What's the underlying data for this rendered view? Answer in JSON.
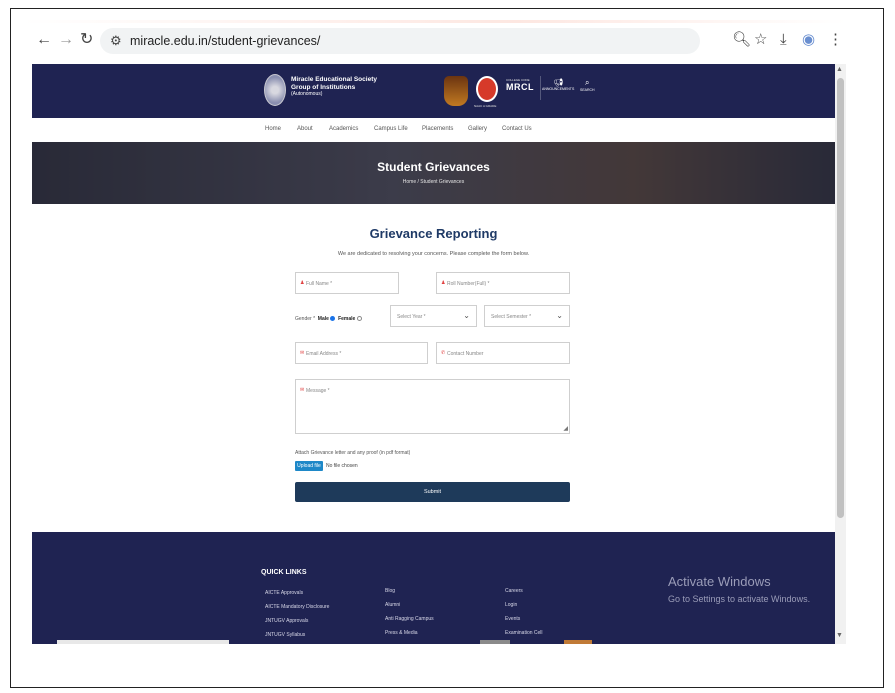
{
  "browser": {
    "url": "miracle.edu.in/student-grievances/"
  },
  "header": {
    "society_line1": "Miracle Educational Society",
    "society_line2": "Group of Institutions",
    "society_line3": "(Autonomous)",
    "mrcl_small": "COLLEGE CODE",
    "mrcl": "MRCL",
    "badge_label": "NAAC A GRADE",
    "announcements": "ANNOUNCEMENTS",
    "search": "SEARCH"
  },
  "nav": {
    "items": [
      "Home",
      "About",
      "Academics",
      "Campus Life",
      "Placements",
      "Gallery",
      "Contact Us"
    ]
  },
  "banner": {
    "title": "Student Grievances",
    "breadcrumb": "Home / Student Grievances"
  },
  "form": {
    "title": "Grievance Reporting",
    "subtitle": "We are dedicated to resolving your concerns. Please complete the form below.",
    "full_name_ph": "Full Name *",
    "roll_number_ph": "Roll Number(Full) *",
    "gender_label": "Gender *",
    "gender_male": "Male",
    "gender_female": "Female",
    "year_ph": "Select Year *",
    "semester_ph": "Select Semester *",
    "email_ph": "Email Address *",
    "contact_ph": "Contact Number",
    "message_ph": "Message *",
    "attach_label": "Attach Grievance letter and any proof (in pdf format)",
    "upload_label": "Upload file",
    "no_file": "No file chosen",
    "submit_label": "Submit"
  },
  "footer": {
    "quick_links_title": "QUICK LINKS",
    "col1": [
      "AICTE Approvals",
      "AICTE Mandatory Disclosure",
      "JNTUGV Approvals",
      "JNTUGV Syllabus"
    ],
    "col2": [
      "Blog",
      "Alumni",
      "Anti Ragging Campus",
      "Press & Media"
    ],
    "col3": [
      "Careers",
      "Login",
      "Events",
      "Examination Cell"
    ]
  },
  "watermark": {
    "line1": "Activate Windows",
    "line2": "Go to Settings to activate Windows."
  }
}
